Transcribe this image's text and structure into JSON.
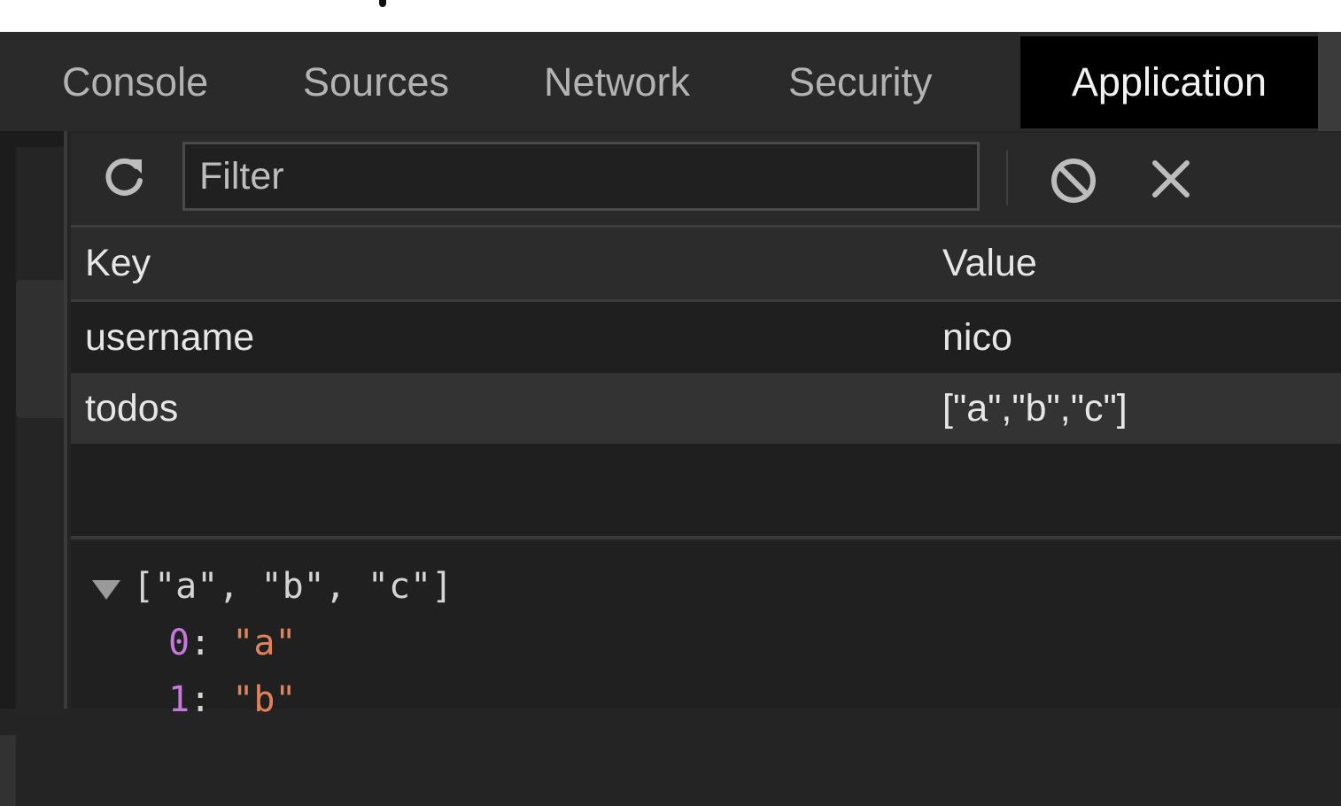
{
  "tabs": [
    {
      "label": "Console"
    },
    {
      "label": "Sources"
    },
    {
      "label": "Network"
    },
    {
      "label": "Security"
    },
    {
      "label": "Application",
      "active": true
    }
  ],
  "toolbar": {
    "filter_placeholder": "Filter",
    "icons": [
      "refresh-icon",
      "clear-icon",
      "close-icon"
    ]
  },
  "table": {
    "columns": [
      "Key",
      "Value"
    ],
    "rows": [
      {
        "key": "username",
        "value": "nico"
      },
      {
        "key": "todos",
        "value": "[\"a\",\"b\",\"c\"]",
        "selected": true
      }
    ]
  },
  "preview": {
    "summary": "[\"a\", \"b\", \"c\"]",
    "items": [
      {
        "index": "0",
        "value": "\"a\""
      },
      {
        "index": "1",
        "value": "\"b\""
      }
    ]
  },
  "colors": {
    "background": "#242424",
    "active_tab": "#000000",
    "index_color": "#c679dd",
    "string_color": "#e0835c"
  }
}
